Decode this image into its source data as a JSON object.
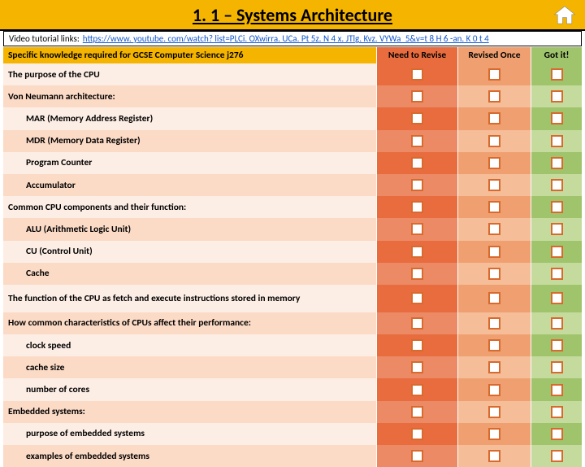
{
  "title": "1. 1 – Systems Architecture",
  "links_label": "Video tutorial links:",
  "video_link": "https://www. youtube. com/watch? list=PLCi. OXwirra. UCa. Pt 5z. N 4 x. JTlg. Kvz. VYWa_5&v=t 8 H 6 -an. K 0 t 4",
  "headers": {
    "knowledge": "Specific knowledge required for GCSE Computer Science j276",
    "revise": "Need to Revise",
    "once": "Revised Once",
    "got": "Got it!"
  },
  "rows": [
    {
      "text": "The purpose of the CPU",
      "indent": false,
      "tall": false
    },
    {
      "text": "Von Neumann architecture:",
      "indent": false,
      "tall": false
    },
    {
      "text": "MAR (Memory Address Register)",
      "indent": true,
      "tall": false
    },
    {
      "text": "MDR (Memory Data Register)",
      "indent": true,
      "tall": false
    },
    {
      "text": "Program Counter",
      "indent": true,
      "tall": false
    },
    {
      "text": "Accumulator",
      "indent": true,
      "tall": false
    },
    {
      "text": "Common CPU components and their function:",
      "indent": false,
      "tall": false
    },
    {
      "text": "ALU (Arithmetic Logic Unit)",
      "indent": true,
      "tall": false
    },
    {
      "text": "CU (Control Unit)",
      "indent": true,
      "tall": false
    },
    {
      "text": "Cache",
      "indent": true,
      "tall": false
    },
    {
      "text": "The function of the CPU as fetch and execute instructions stored in memory",
      "indent": false,
      "tall": true
    },
    {
      "text": "How common characteristics of CPUs affect their performance:",
      "indent": false,
      "tall": false
    },
    {
      "text": "clock speed",
      "indent": true,
      "tall": false
    },
    {
      "text": "cache size",
      "indent": true,
      "tall": false
    },
    {
      "text": "number of cores",
      "indent": true,
      "tall": false
    },
    {
      "text": "Embedded systems:",
      "indent": false,
      "tall": false
    },
    {
      "text": "purpose of embedded systems",
      "indent": true,
      "tall": false
    },
    {
      "text": "examples of embedded systems",
      "indent": true,
      "tall": false
    }
  ]
}
